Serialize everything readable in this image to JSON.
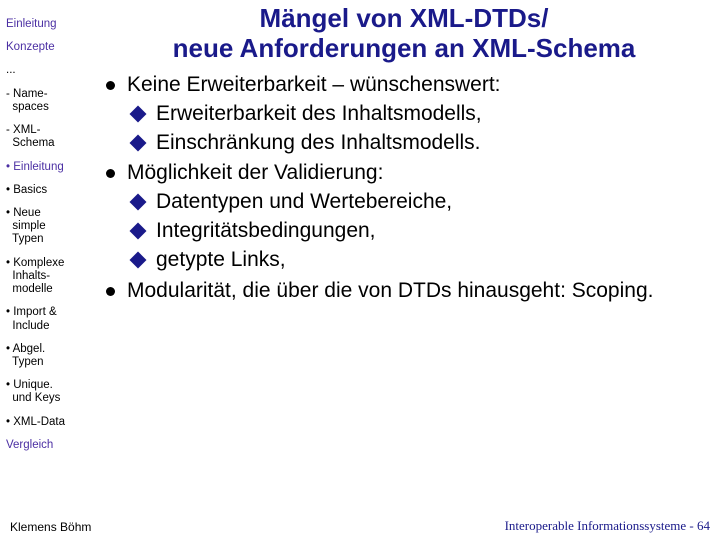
{
  "sidebar": {
    "items": [
      {
        "label": "Einleitung",
        "cls": "purple"
      },
      {
        "label": "Konzepte",
        "cls": "purple"
      },
      {
        "label": "...",
        "cls": ""
      },
      {
        "label": "- Name-\n  spaces",
        "cls": ""
      },
      {
        "label": "- XML-\n  Schema",
        "cls": ""
      },
      {
        "label": "• Einleitung",
        "cls": "purple"
      },
      {
        "label": "• Basics",
        "cls": ""
      },
      {
        "label": "• Neue\n  simple\n  Typen",
        "cls": ""
      },
      {
        "label": "• Komplexe\n  Inhalts-\n  modelle",
        "cls": ""
      },
      {
        "label": "• Import &\n  Include",
        "cls": ""
      },
      {
        "label": "• Abgel.\n  Typen",
        "cls": ""
      },
      {
        "label": "• Unique.\n  und Keys",
        "cls": ""
      },
      {
        "label": "• XML-Data",
        "cls": ""
      },
      {
        "label": "Vergleich",
        "cls": "purple"
      }
    ]
  },
  "title": {
    "line1": "Mängel von XML-DTDs/",
    "line2": "neue Anforderungen an XML-Schema"
  },
  "content": {
    "b1_1": "Keine Erweiterbarkeit – wünschenswert:",
    "b2_1": "Erweiterbarkeit des Inhaltsmodells,",
    "b2_2": "Einschränkung des Inhaltsmodells.",
    "b1_2": "Möglichkeit der Validierung:",
    "b2_3": "Datentypen und Wertebereiche,",
    "b2_4": "Integritätsbedingungen,",
    "b2_5": "getypte Links,",
    "b1_3": "Modularität, die über die von DTDs hinausgeht: Scoping."
  },
  "footer": {
    "left": "Klemens Böhm",
    "right": "Interoperable Informationssysteme - 64"
  }
}
